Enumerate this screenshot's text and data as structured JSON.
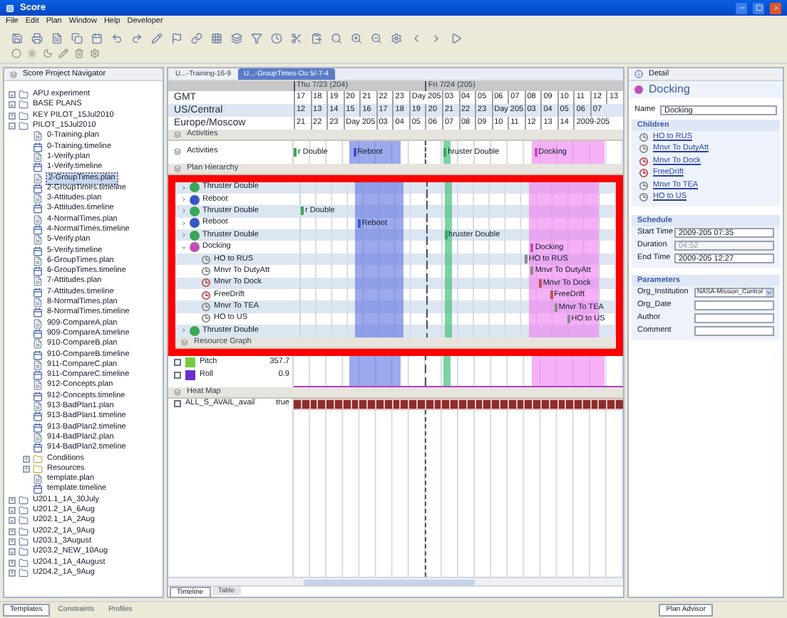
{
  "window": {
    "title": "Score"
  },
  "menu": [
    "File",
    "Edit",
    "Plan",
    "Window",
    "Help",
    "Developer"
  ],
  "navigator": {
    "title": "Score Project Navigator",
    "tree": [
      {
        "label": "APU experiment",
        "kind": "project",
        "expanded": false,
        "selected": false
      },
      {
        "label": "BASE PLANS",
        "kind": "project",
        "expanded": false,
        "selected": false
      },
      {
        "label": "KEY PILOT_15Jul2010",
        "kind": "project",
        "expanded": false,
        "selected": false
      },
      {
        "label": "PILOT_15Jul2010",
        "kind": "project",
        "expanded": true,
        "selected": false,
        "children": [
          {
            "label": "0-Training.plan",
            "kind": "plan",
            "selected": false
          },
          {
            "label": "0-Training.timeline",
            "kind": "timeline",
            "selected": false
          },
          {
            "label": "1-Verify.plan",
            "kind": "plan",
            "selected": false
          },
          {
            "label": "1-Verify.timeline",
            "kind": "timeline",
            "selected": false
          },
          {
            "label": "2-GroupTimes.plan",
            "kind": "plan",
            "selected": true
          },
          {
            "label": "2-GroupTimes.timeline",
            "kind": "timeline",
            "selected": false
          },
          {
            "label": "3-Attitudes.plan",
            "kind": "plan",
            "selected": false
          },
          {
            "label": "3-Attitudes.timeline",
            "kind": "timeline",
            "selected": false
          },
          {
            "label": "4-NormalTimes.plan",
            "kind": "plan",
            "selected": false
          },
          {
            "label": "4-NormalTimes.timeline",
            "kind": "timeline",
            "selected": false
          },
          {
            "label": "5-Verify.plan",
            "kind": "plan",
            "selected": false
          },
          {
            "label": "5-Verify.timeline",
            "kind": "timeline",
            "selected": false
          },
          {
            "label": "6-GroupTimes.plan",
            "kind": "plan",
            "selected": false
          },
          {
            "label": "6-GroupTimes.timeline",
            "kind": "timeline",
            "selected": false
          },
          {
            "label": "7-Attitudes.plan",
            "kind": "plan",
            "selected": false
          },
          {
            "label": "7-Attitudes.timeline",
            "kind": "timeline",
            "selected": false
          },
          {
            "label": "8-NormalTimes.plan",
            "kind": "plan",
            "selected": false
          },
          {
            "label": "8-NormalTimes.timeline",
            "kind": "timeline",
            "selected": false
          },
          {
            "label": "909-CompareA.plan",
            "kind": "plan",
            "selected": false
          },
          {
            "label": "909-CompareA.timeline",
            "kind": "timeline",
            "selected": false
          },
          {
            "label": "910-CompareB.plan",
            "kind": "plan",
            "selected": false
          },
          {
            "label": "910-CompareB.timeline",
            "kind": "timeline",
            "selected": false
          },
          {
            "label": "911-CompareC.plan",
            "kind": "plan",
            "selected": false
          },
          {
            "label": "911-CompareC.timeline",
            "kind": "timeline",
            "selected": false
          },
          {
            "label": "912-Concepts.plan",
            "kind": "plan",
            "selected": false
          },
          {
            "label": "912-Concepts.timeline",
            "kind": "timeline",
            "selected": false
          },
          {
            "label": "913-BadPlan1.plan",
            "kind": "plan",
            "selected": false
          },
          {
            "label": "913-BadPlan1.timeline",
            "kind": "timeline",
            "selected": false
          },
          {
            "label": "913-BadPlan2.timeline",
            "kind": "timeline",
            "selected": false
          },
          {
            "label": "914-BadPlan2.plan",
            "kind": "plan",
            "selected": false
          },
          {
            "label": "914-BadPlan2.timeline",
            "kind": "timeline",
            "selected": false
          },
          {
            "label": "Conditions",
            "kind": "folder",
            "expanded": false,
            "selected": false
          },
          {
            "label": "Resources",
            "kind": "folder",
            "expanded": false,
            "selected": false
          },
          {
            "label": "template.plan",
            "kind": "plan",
            "selected": false
          },
          {
            "label": "template.timeline",
            "kind": "timeline",
            "selected": false
          }
        ]
      },
      {
        "label": "U201.1_1A_30July",
        "kind": "project",
        "expanded": false,
        "selected": false
      },
      {
        "label": "U201.2_1A_6Aug",
        "kind": "project",
        "expanded": false,
        "selected": false
      },
      {
        "label": "U202.1_1A_2Aug",
        "kind": "project",
        "expanded": false,
        "selected": false
      },
      {
        "label": "U202.2_1A_9Aug",
        "kind": "project",
        "expanded": false,
        "selected": false
      },
      {
        "label": "U203.1_3August",
        "kind": "project",
        "expanded": false,
        "selected": false
      },
      {
        "label": "U203.2_NEW_10Aug",
        "kind": "project",
        "expanded": false,
        "selected": false
      },
      {
        "label": "U204.1_1A_4August",
        "kind": "project",
        "expanded": false,
        "selected": false
      },
      {
        "label": "U204.2_1A_9Aug",
        "kind": "project",
        "expanded": false,
        "selected": false
      }
    ]
  },
  "editor_tabs": [
    {
      "label": "U...-Training-16-9",
      "selected": false
    },
    {
      "label": "U...-GroupTimes-Ou 5/-7-4",
      "selected": true
    }
  ],
  "timeline": {
    "days": [
      "Thu 7/23 (204)",
      "Fri 7/24 (205)"
    ],
    "zones": [
      {
        "name": "GMT",
        "cells": [
          {
            "text": "17",
            "kind": "hour"
          },
          {
            "text": "18",
            "kind": "hour"
          },
          {
            "text": "19",
            "kind": "hour"
          },
          {
            "text": "20",
            "kind": "hour"
          },
          {
            "text": "21",
            "kind": "hour"
          },
          {
            "text": "22",
            "kind": "hour"
          },
          {
            "text": "23",
            "kind": "hour"
          },
          {
            "text": "Day 205",
            "kind": "date"
          },
          {
            "text": "03",
            "kind": "hour"
          },
          {
            "text": "04",
            "kind": "hour"
          },
          {
            "text": "05",
            "kind": "hour"
          },
          {
            "text": "06",
            "kind": "hour"
          },
          {
            "text": "07",
            "kind": "hour"
          },
          {
            "text": "08",
            "kind": "hour"
          },
          {
            "text": "09",
            "kind": "hour"
          },
          {
            "text": "10",
            "kind": "hour"
          },
          {
            "text": "11",
            "kind": "hour"
          },
          {
            "text": "12",
            "kind": "hour"
          },
          {
            "text": "13",
            "kind": "hour"
          }
        ]
      },
      {
        "name": "US/Central",
        "cells": [
          {
            "text": "12",
            "kind": "hour"
          },
          {
            "text": "13",
            "kind": "hour"
          },
          {
            "text": "14",
            "kind": "hour"
          },
          {
            "text": "15",
            "kind": "hour"
          },
          {
            "text": "16",
            "kind": "hour"
          },
          {
            "text": "17",
            "kind": "hour"
          },
          {
            "text": "18",
            "kind": "hour"
          },
          {
            "text": "19",
            "kind": "hour"
          },
          {
            "text": "20",
            "kind": "hour"
          },
          {
            "text": "21",
            "kind": "hour"
          },
          {
            "text": "22",
            "kind": "hour"
          },
          {
            "text": "23",
            "kind": "hour"
          },
          {
            "text": "Day 205",
            "kind": "date"
          },
          {
            "text": "03",
            "kind": "hour"
          },
          {
            "text": "04",
            "kind": "hour"
          },
          {
            "text": "05",
            "kind": "hour"
          },
          {
            "text": "06",
            "kind": "hour"
          },
          {
            "text": "07",
            "kind": "hour"
          }
        ]
      },
      {
        "name": "Europe/Moscow",
        "cells": [
          {
            "text": "21",
            "kind": "hour"
          },
          {
            "text": "22",
            "kind": "hour"
          },
          {
            "text": "23",
            "kind": "hour"
          },
          {
            "text": "Day 205",
            "kind": "date"
          },
          {
            "text": "03",
            "kind": "hour"
          },
          {
            "text": "04",
            "kind": "hour"
          },
          {
            "text": "05",
            "kind": "hour"
          },
          {
            "text": "06",
            "kind": "hour"
          },
          {
            "text": "07",
            "kind": "hour"
          },
          {
            "text": "08",
            "kind": "hour"
          },
          {
            "text": "09",
            "kind": "hour"
          },
          {
            "text": "10",
            "kind": "hour"
          },
          {
            "text": "11",
            "kind": "hour"
          },
          {
            "text": "12",
            "kind": "hour"
          },
          {
            "text": "13",
            "kind": "hour"
          },
          {
            "text": "14",
            "kind": "hour"
          },
          {
            "text": "2009-205",
            "kind": "date"
          }
        ]
      }
    ],
    "activities": {
      "title": "Activities",
      "label": "Activities",
      "bars": [
        {
          "text": "r Double",
          "kind": "thruster"
        },
        {
          "text": "Reboot",
          "kind": "reboot"
        },
        {
          "text": "hruster Double",
          "kind": "thruster"
        },
        {
          "text": "Docking",
          "kind": "docking"
        }
      ]
    },
    "hierarchy": {
      "title": "Plan Hierarchy",
      "rows": [
        {
          "label": "Thruster Double",
          "kind": "thruster",
          "expanded": false
        },
        {
          "label": "Reboot",
          "kind": "reboot",
          "expanded": false
        },
        {
          "label": "Thruster Double",
          "kind": "thruster",
          "expanded": false,
          "bar": "r Double"
        },
        {
          "label": "Reboot",
          "kind": "reboot",
          "expanded": false,
          "bar": "Reboot"
        },
        {
          "label": "Thruster Double",
          "kind": "thruster",
          "expanded": false,
          "bar": "hruster Double"
        },
        {
          "label": "Docking",
          "kind": "docking",
          "expanded": true,
          "bar": "Docking",
          "children": [
            {
              "label": "HO to RUS",
              "kind": "step",
              "bar": "HO to RUS"
            },
            {
              "label": "Mnvr To DutyAtt",
              "kind": "step",
              "bar": "Mnvr To DutyAtt"
            },
            {
              "label": "Mnvr To Dock",
              "kind": "drift",
              "bar": "Mnvr To Dock"
            },
            {
              "label": "FreeDrift",
              "kind": "drift",
              "bar": "FreeDrift"
            },
            {
              "label": "Mnvr To TEA",
              "kind": "step",
              "bar": "Mnvr To TEA"
            },
            {
              "label": "HO to US",
              "kind": "step",
              "bar": "HO to US"
            }
          ]
        },
        {
          "label": "Thruster Double",
          "kind": "thruster",
          "expanded": false
        }
      ]
    },
    "resources": {
      "title": "Resource Graph",
      "rows": [
        {
          "name": "Pitch",
          "value": "357.7",
          "color": "#7ac943",
          "checked": false
        },
        {
          "name": "Roll",
          "value": "0.9",
          "color": "#6a2fd0",
          "checked": false
        }
      ]
    },
    "heatmap": {
      "title": "Heat Map",
      "rows": [
        {
          "name": "ALL_S_AVAIL_avail",
          "value": "true",
          "checked": false
        }
      ]
    }
  },
  "editor_bottom_tabs": [
    {
      "label": "Timeline",
      "selected": true
    },
    {
      "label": "Table",
      "selected": false
    }
  ],
  "detail": {
    "tab": "Detail",
    "title": "Docking",
    "name_label": "Name",
    "name_value": "Docking",
    "children_title": "Children",
    "children": [
      {
        "label": "HO to RUS",
        "kind": "step"
      },
      {
        "label": "Mnvr To DutyAtt",
        "kind": "step"
      },
      {
        "label": "Mnvr To Dock",
        "kind": "drift"
      },
      {
        "label": "FreeDrift",
        "kind": "drift"
      },
      {
        "label": "Mnvr To TEA",
        "kind": "step"
      },
      {
        "label": "HO to US",
        "kind": "step"
      }
    ],
    "schedule_title": "Schedule",
    "schedule": [
      {
        "label": "Start Time",
        "value": "2009-205 07:35",
        "disabled": false
      },
      {
        "label": "Duration",
        "value": "04:52",
        "disabled": true
      },
      {
        "label": "End Time",
        "value": "2009-205 12:27",
        "disabled": false
      }
    ],
    "parameters_title": "Parameters",
    "parameters": [
      {
        "label": "Org_Institution",
        "value": "NASA-Mission_Control",
        "kind": "dropdown"
      },
      {
        "label": "Org_Date",
        "kind": "text"
      },
      {
        "label": "Author",
        "kind": "text"
      },
      {
        "label": "Comment",
        "kind": "text"
      }
    ]
  },
  "bottom_tabs": [
    {
      "label": "Templates",
      "selected": true
    },
    {
      "label": "Constraints",
      "selected": false
    },
    {
      "label": "Profiles",
      "selected": false
    }
  ],
  "advisor_tab": "Plan Advisor"
}
